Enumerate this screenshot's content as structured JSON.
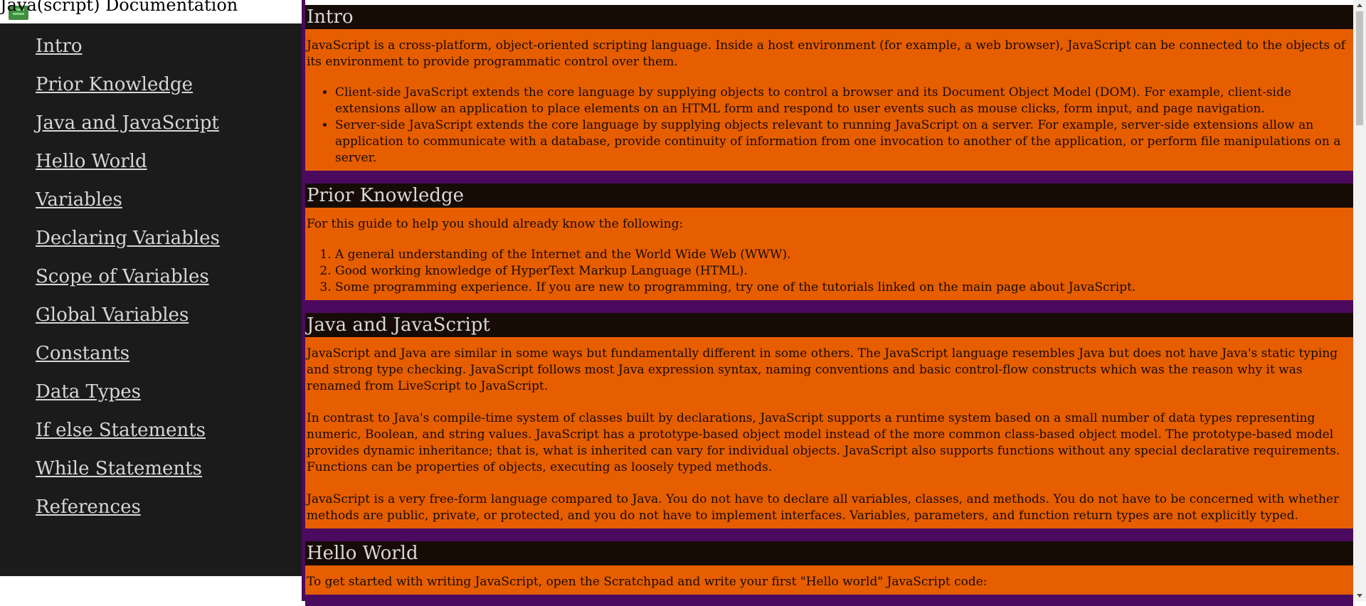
{
  "navbar": {
    "title": "Java(script) Documentation",
    "links": [
      "Intro",
      "Prior Knowledge",
      "Java and JavaScript",
      "Hello World",
      "Variables",
      "Declaring Variables",
      "Scope of Variables",
      "Global Variables",
      "Constants",
      "Data Types",
      "If else Statements",
      "While Statements",
      "References"
    ]
  },
  "sections": {
    "intro": {
      "title": "Intro",
      "p1": "JavaScript is a cross-platform, object-oriented scripting language. Inside a host environment (for example, a web browser), JavaScript can be connected to the objects of its environment to provide programmatic control over them.",
      "bullets": [
        "Client-side JavaScript extends the core language by supplying objects to control a browser and its Document Object Model (DOM). For example, client-side extensions allow an application to place elements on an HTML form and respond to user events such as mouse clicks, form input, and page navigation.",
        "Server-side JavaScript extends the core language by supplying objects relevant to running JavaScript on a server. For example, server-side extensions allow an application to communicate with a database, provide continuity of information from one invocation to another of the application, or perform file manipulations on a server."
      ]
    },
    "prior": {
      "title": "Prior Knowledge",
      "p1": "For this guide to help you should already know the following:",
      "items": [
        "A general understanding of the Internet and the World Wide Web (WWW).",
        "Good working knowledge of HyperText Markup Language (HTML).",
        "Some programming experience. If you are new to programming, try one of the tutorials linked on the main page about JavaScript."
      ]
    },
    "java": {
      "title": "Java and JavaScript",
      "p1": "JavaScript and Java are similar in some ways but fundamentally different in some others. The JavaScript language resembles Java but does not have Java's static typing and strong type checking. JavaScript follows most Java expression syntax, naming conventions and basic control-flow constructs which was the reason why it was renamed from LiveScript to JavaScript.",
      "p2": "In contrast to Java's compile-time system of classes built by declarations, JavaScript supports a runtime system based on a small number of data types representing numeric, Boolean, and string values. JavaScript has a prototype-based object model instead of the more common class-based object model. The prototype-based model provides dynamic inheritance; that is, what is inherited can vary for individual objects. JavaScript also supports functions without any special declarative requirements. Functions can be properties of objects, executing as loosely typed methods.",
      "p3": "JavaScript is a very free-form language compared to Java. You do not have to declare all variables, classes, and methods. You do not have to be concerned with whether methods are public, private, or protected, and you do not have to implement interfaces. Variables, parameters, and function return types are not explicitly typed."
    },
    "hello": {
      "title": "Hello World",
      "p1": "To get started with writing JavaScript, open the Scratchpad and write your first \"Hello world\" JavaScript code:"
    }
  },
  "colors": {
    "navbar_bg": "#1b1b1b",
    "section_bg": "#e65e00",
    "header_bg": "#170c05",
    "separator": "#4b0a5e"
  }
}
